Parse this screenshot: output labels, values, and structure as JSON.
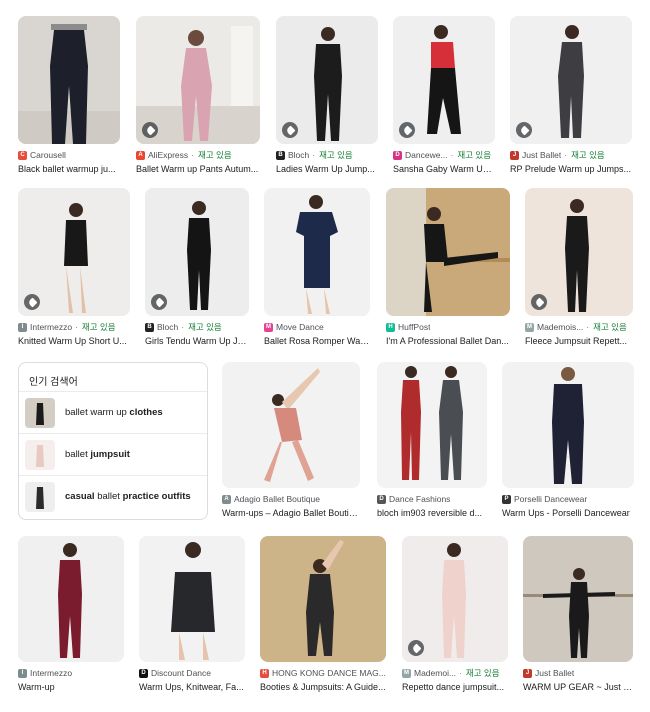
{
  "colors": {
    "stock": "#188038",
    "source_text": "#4d5156"
  },
  "cards": [
    {
      "source": "Carousell",
      "stock": "",
      "title": "Black ballet warmup ju...",
      "favicon": "carousell-icon",
      "fav_color": "#e74c3c",
      "badge": false
    },
    {
      "source": "AliExpress",
      "stock": "재고 있음",
      "title": "Ballet Warm up Pants Autum...",
      "favicon": "aliexpress-icon",
      "fav_color": "#e8492d",
      "badge": true
    },
    {
      "source": "Bloch",
      "stock": "재고 있음",
      "title": "Ladies Warm Up Jump...",
      "favicon": "bloch-icon",
      "fav_color": "#222222",
      "badge": true
    },
    {
      "source": "Dancewe...",
      "stock": "재고 있음",
      "title": "Sansha Gaby Warm Up ...",
      "favicon": "dancewear-icon",
      "fav_color": "#d63384",
      "badge": true
    },
    {
      "source": "Just Ballet",
      "stock": "재고 있음",
      "title": "RP Prelude Warm up Jumps...",
      "favicon": "justballet-icon",
      "fav_color": "#c0392b",
      "badge": true
    },
    {
      "source": "Intermezzo",
      "stock": "재고 있음",
      "title": "Knitted Warm Up Short U...",
      "favicon": "intermezzo-icon",
      "fav_color": "#7f8c8d",
      "badge": true
    },
    {
      "source": "Bloch",
      "stock": "재고 있음",
      "title": "Girls Tendu Warm Up Ju...",
      "favicon": "bloch-icon",
      "fav_color": "#222222",
      "badge": true
    },
    {
      "source": "Move Dance",
      "stock": "",
      "title": "Ballet Rosa Romper War...",
      "favicon": "movedance-icon",
      "fav_color": "#e84393",
      "badge": false
    },
    {
      "source": "HuffPost",
      "stock": "",
      "title": "I'm A Professional Ballet Dan...",
      "favicon": "huffpost-icon",
      "fav_color": "#0dbe98",
      "badge": false
    },
    {
      "source": "Mademois...",
      "stock": "재고 있음",
      "title": "Fleece Jumpsuit Repett...",
      "favicon": "mademoiselle-icon",
      "fav_color": "#95a5a6",
      "badge": true
    },
    {
      "source": "Adagio Ballet Boutique",
      "stock": "",
      "title": "Warm-ups – Adagio Ballet Boutiq...",
      "favicon": "adagio-icon",
      "fav_color": "#7f8c8d",
      "badge": false
    },
    {
      "source": "Dance Fashions",
      "stock": "",
      "title": "bloch im903 reversible d...",
      "favicon": "dancefashions-icon",
      "fav_color": "#555555",
      "badge": false
    },
    {
      "source": "Porselli Dancewear",
      "stock": "",
      "title": "Warm Ups - Porselli Dancewear",
      "favicon": "porselli-icon",
      "fav_color": "#333333",
      "badge": false
    },
    {
      "source": "Intermezzo",
      "stock": "",
      "title": "Warm-up",
      "favicon": "intermezzo-icon",
      "fav_color": "#7f8c8d",
      "badge": false
    },
    {
      "source": "Discount Dance",
      "stock": "",
      "title": "Warm Ups, Knitwear, Fa...",
      "favicon": "discountdance-icon",
      "fav_color": "#111111",
      "badge": false
    },
    {
      "source": "HONG KONG DANCE MAG...",
      "stock": "",
      "title": "Booties & Jumpsuits: A Guide...",
      "favicon": "hkdance-icon",
      "fav_color": "#e74c3c",
      "badge": false
    },
    {
      "source": "Mademoi...",
      "stock": "재고 있음",
      "title": "Repetto dance jumpsuit...",
      "favicon": "mademoiselle-icon",
      "fav_color": "#95a5a6",
      "badge": true
    },
    {
      "source": "Just Ballet",
      "stock": "",
      "title": "WARM UP GEAR ~ Just B...",
      "favicon": "justballet-icon",
      "fav_color": "#c0392b",
      "badge": false
    }
  ],
  "popular": {
    "heading": "인기 검색어",
    "items": [
      {
        "pre": "ballet warm up ",
        "bold": "clothes",
        "post": ""
      },
      {
        "pre": "ballet ",
        "bold": "jumpsuit",
        "post": ""
      },
      {
        "pre": "",
        "bold": "casual",
        "mid": " ballet ",
        "bold2": "practice outfits"
      }
    ]
  }
}
